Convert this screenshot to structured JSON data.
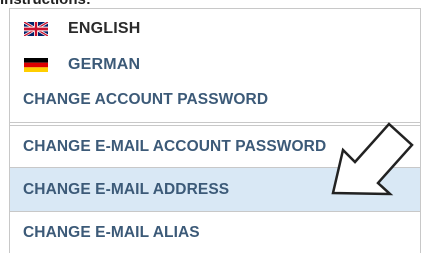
{
  "header_partial": "instructions:",
  "languages": [
    {
      "label": "ENGLISH",
      "flag": "uk-flag-icon"
    },
    {
      "label": "GERMAN",
      "flag": "germany-flag-icon"
    }
  ],
  "menu": {
    "items": [
      {
        "label": "CHANGE ACCOUNT PASSWORD"
      },
      {
        "label": "CHANGE E-MAIL ACCOUNT PASSWORD"
      },
      {
        "label": "CHANGE E-MAIL ADDRESS",
        "highlighted": true
      },
      {
        "label": "CHANGE E-MAIL ALIAS"
      }
    ]
  },
  "colors": {
    "link": "#3c5a78",
    "highlight_bg": "#d9e8f5",
    "border": "#c8c8c8"
  },
  "pointer": "arrow-pointer-icon"
}
